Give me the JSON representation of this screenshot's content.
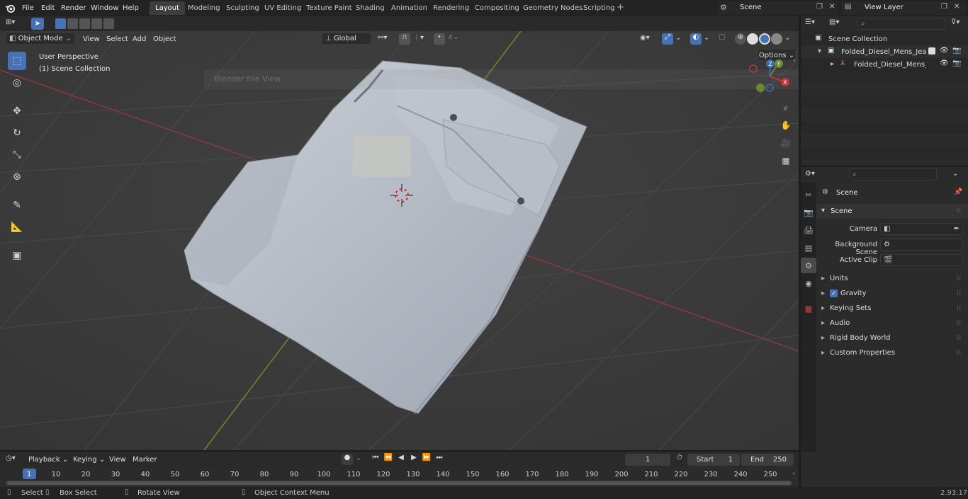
{
  "topbar": {
    "menus": [
      "File",
      "Edit",
      "Render",
      "Window",
      "Help"
    ],
    "workspaces": [
      "Layout",
      "Modeling",
      "Sculpting",
      "UV Editing",
      "Texture Paint",
      "Shading",
      "Animation",
      "Rendering",
      "Compositing",
      "Geometry Nodes",
      "Scripting"
    ],
    "active_workspace": "Layout",
    "scene": "Scene",
    "view_layer": "View Layer"
  },
  "viewport_header": {
    "mode": "Object Mode",
    "menus": [
      "View",
      "Select",
      "Add",
      "Object"
    ],
    "orientation": "Global",
    "options": "Options"
  },
  "viewport": {
    "perspective_label": "User Perspective",
    "collection_label": "(1) Scene Collection",
    "ghost_title": "Blender File View",
    "gizmo": {
      "z": "Z",
      "y": "Y",
      "x": "X"
    }
  },
  "tools": [
    "select-box",
    "cursor",
    "move",
    "rotate",
    "scale",
    "transform",
    "annotate",
    "measure",
    "add-cube"
  ],
  "outliner": {
    "items": [
      {
        "label": "Scene Collection",
        "indent": 0
      },
      {
        "label": "Folded_Diesel_Mens_Jeans_Gr",
        "indent": 1
      },
      {
        "label": "Folded_Diesel_Mens_Jear",
        "indent": 2
      }
    ]
  },
  "properties": {
    "context": "Scene",
    "section": "Scene",
    "fields": [
      {
        "label": "Camera",
        "value": ""
      },
      {
        "label": "Background Scene",
        "value": ""
      },
      {
        "label": "Active Clip",
        "value": ""
      }
    ],
    "panels": [
      "Units",
      "Gravity",
      "Keying Sets",
      "Audio",
      "Rigid Body World",
      "Custom Properties"
    ],
    "gravity_checked": true
  },
  "timeline": {
    "menus": [
      "Playback",
      "Keying",
      "View",
      "Marker"
    ],
    "current_frame": "1",
    "start_label": "Start",
    "start": "1",
    "end_label": "End",
    "end": "250",
    "ticks": [
      "1",
      "10",
      "20",
      "30",
      "40",
      "50",
      "60",
      "70",
      "80",
      "90",
      "100",
      "110",
      "120",
      "130",
      "140",
      "150",
      "160",
      "170",
      "180",
      "190",
      "200",
      "210",
      "220",
      "230",
      "240",
      "250"
    ]
  },
  "statusbar": {
    "select": "Select",
    "box_select": "Box Select",
    "rotate_view": "Rotate View",
    "context_menu": "Object Context Menu",
    "version": "2.93.17"
  }
}
